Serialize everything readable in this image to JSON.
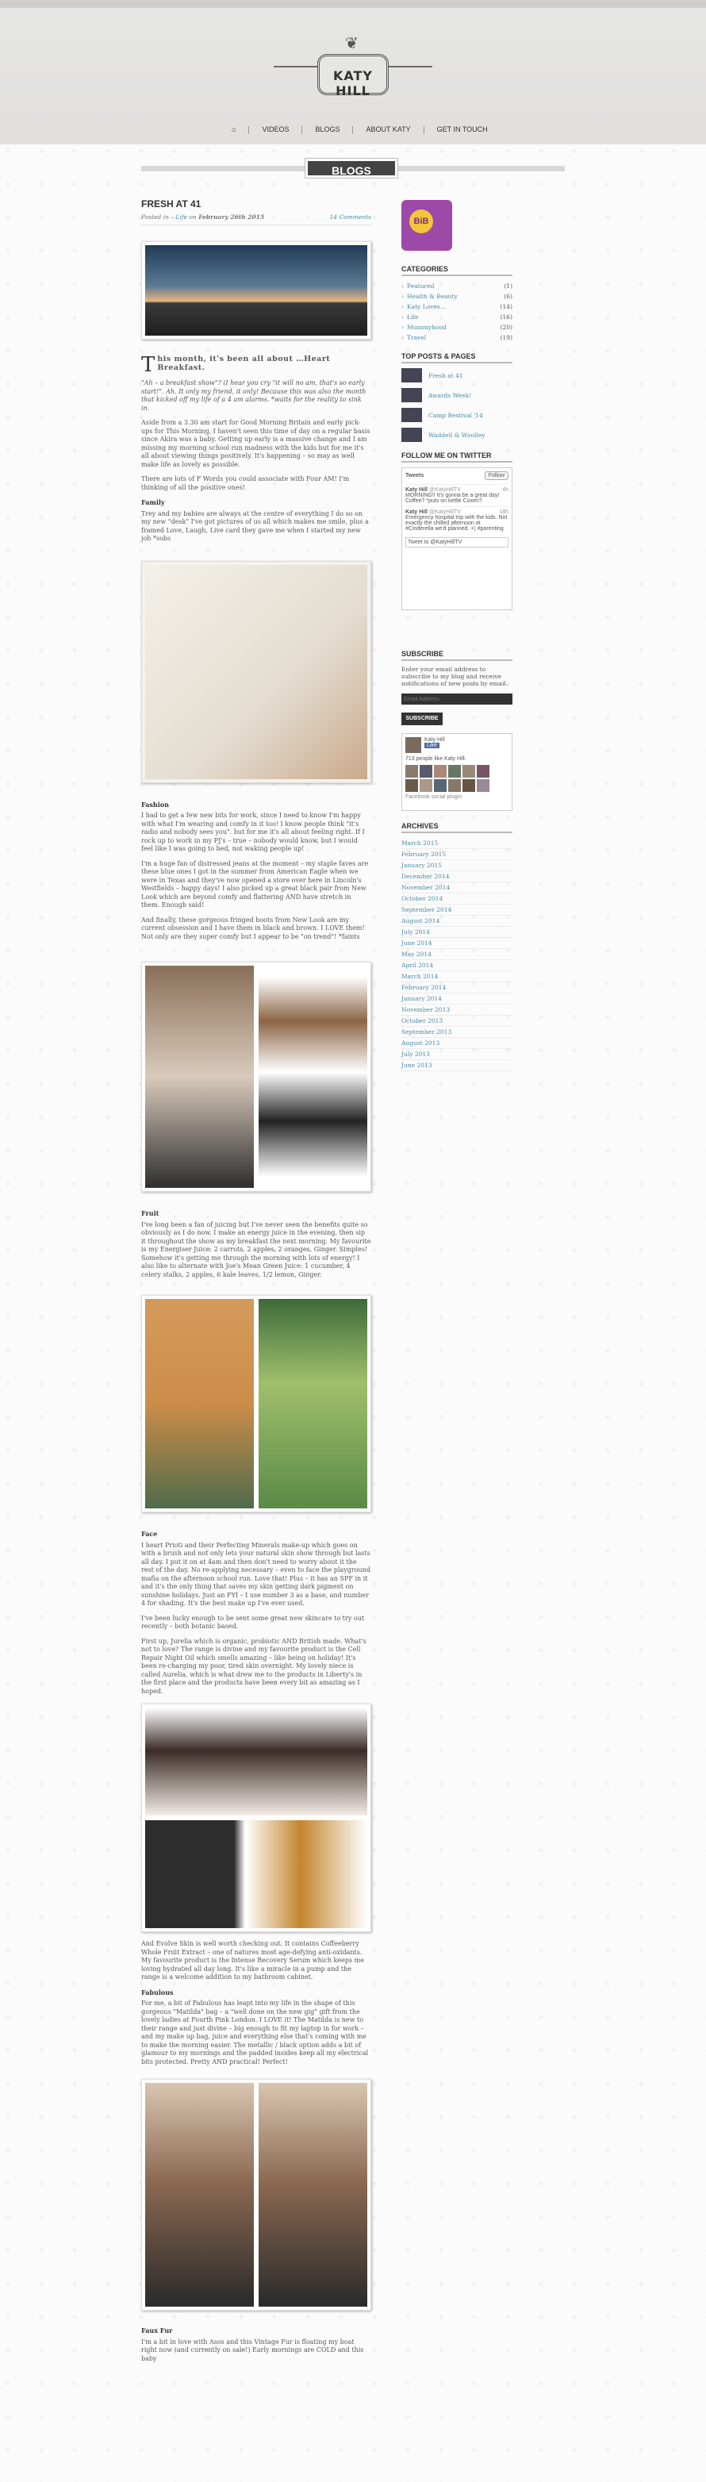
{
  "site": {
    "brand": "KATY HILL"
  },
  "nav": {
    "home": "⌂",
    "videos": "VIDEOS",
    "blogs": "BLOGS",
    "about": "ABOUT KATY",
    "contact": "GET IN TOUCH"
  },
  "section_tag": "BLOGS",
  "post": {
    "title": "FRESH AT 41",
    "posted_in": "Posted in – ",
    "category": "Life",
    "on": " on ",
    "date": "February 26th 2015",
    "comments": "14 Comments",
    "intro_drop": "T",
    "intro_rest": "his month, it's been all about …Heart Breakfast.",
    "p1": "\"Ah – a breakfast show\"? (I hear you cry \"it will no am, that's so early start!\". Ah. It only my friend, it only! Because this was also the month that kicked off my life of a 4 am alarms. *waits for the reality to sink in.",
    "p2": "Aside from a 3.30 am start for Good Morning Britain and early pick-ups for This Morning, I haven't seen this time of day on a regular basis since Akira was a baby. Getting up early is a massive change and I am missing my morning school run madness with the kids but for me it's all about viewing things positively. It's happening – so may as well make life as lovely as possible.",
    "p3": "There are lots of F Words you could associate with Four AM! I'm thinking of all the positive ones!",
    "family_h": "Family",
    "p4": "Trey and my babies are always at the centre of everything I do so on my new \"desk\" I've got pictures of us all which makes me smile, plus a framed Love, Laugh, Live card they gave me when I started my new job *sobs",
    "fashion_h": "Fashion",
    "p5": "I had to get a few new bits for work, since I need to know I'm happy with what I'm wearing and comfy in it too! I know people think \"it's radio and nobody sees you\". but for me it's all about feeling right. If I rock up to work in my PJ's – true – nobody would know, but I would feel like I was going to bed, not waking people up!",
    "p6": "I'm a huge fan of distressed jeans at the moment – my staple faves are these blue ones I got in the summer from American Eagle when we were in Texas and they've now opened a store over here in Lincoln's Westfields – happy days! I also picked up a great black pair from New Look which are beyond comfy and flattering AND have stretch in them. Enough said!",
    "p7": "And finally, these gorgeous fringed boots from New Look are my current obsession and I have them in black and brown. I LOVE them! Not only are they super comfy but I appear to be \"on trend\"! *faints",
    "fruit_h": "Fruit",
    "p8": "I've long been a fan of juicing but I've never seen the benefits quite so obviously as I do now. I make an energy juice in the evening, then sip it throughout the show as my breakfast the next morning. My favourite is my Energiser Juice: 2 carrots, 2 apples, 2 oranges, Ginger. Simples! Somehow it's getting me through the morning with lots of energy! I also like to alternate with Joe's Mean Green Juice: 1 cucumber, 4 celery stalks, 2 apples, 6 kale leaves, 1/2 lemon, Ginger.",
    "face_h": "Face",
    "p9": "I heart Prioti and their Perfecting Minerals make-up which goes on with a brush and not only lets your natural skin show through but lasts all day. I put it on at 4am and then don't need to worry about it the rest of the day. No re-applying necessary – even to face the playground mafia on the afternoon school run. Love that! Plus – it has an SPF in it and it's the only thing that saves my skin getting dark pigment on sunshine holidays. Just an FYI – I use number 3 as a base, and number 4 for shading. It's the best make up I've ever used.",
    "p10": "I've been lucky enough to be sent some great new skincare to try out recently – both botanic based.",
    "p11": "First up, Jurelia which is organic, probiotic AND British made. What's not to love? The range is divine and my favourite product is the Cell Repair Night Oil which smells amazing – like being on holiday! It's been re-charging my poor, tired skin overnight. My lovely niece is called Aurelia, which is what drew me to the products in Liberty's in the first place and the products have been every bit as amazing as I hoped.",
    "p12": "And Evolve Skin is well worth checking out. It contains Coffeeberry Whole Fruit Extract – one of natures most age-defying anti-oxidants. My favourite product is the Intense Recovery Serum which keeps me loving hydrated all day long. It's like a miracle in a pump and the range is a welcome addition to my bathroom cabinet.",
    "fab_h": "Fabulous",
    "p13": "For me, a bit of Fabulous has leapt into my life in the shape of this gorgeous \"Matilda\" bag – a \"well done on the new gig\" gift from the lovely ladies at Fourth Pink London. I LOVE it! The Matilda is new to their range and just divine – big enough to fit my laptop in for work – and my make up bag, juice and everything else that's coming with me to make the morning easier. The metallic / black option adds a bit of glamour to my mornings and the padded insides keep all my electrical bits protected. Pretty AND practical! Perfect!",
    "faux_h": "Faux Fur",
    "p14": "I'm a bit in love with Asos and this Vintage Fur is floating my boat right now (and currently on sale!) Early mornings are COLD and this baby"
  },
  "sidebar": {
    "badge": "BiB",
    "categories_h": "CATEGORIES",
    "categories": [
      {
        "name": "Featured",
        "count": "(1)"
      },
      {
        "name": "Health & Beauty",
        "count": "(6)"
      },
      {
        "name": "Katy Loves…",
        "count": "(14)"
      },
      {
        "name": "Life",
        "count": "(16)"
      },
      {
        "name": "Mummyhood",
        "count": "(20)"
      },
      {
        "name": "Travel",
        "count": "(19)"
      }
    ],
    "top_h": "TOP POSTS & PAGES",
    "top": [
      "Fresh at 41",
      "Awards Week!",
      "Camp Bestival '14",
      "Waddell & Woolley"
    ],
    "twitter_h": "FOLLOW ME ON TWITTER",
    "tweets_label": "Tweets",
    "follow": "Follow",
    "tweet1_name": "Katy Hill",
    "tweet1_handle": "@KatyHillTV",
    "tweet1_time": "4h",
    "tweet1_text": "MORNING!! It's gonna be a great day! Coffee? *puts on kettle Coxen?",
    "tweet2_name": "Katy Hill",
    "tweet2_handle": "@KatyHillTV",
    "tweet2_time": "18h",
    "tweet2_text": "Emergency hospital trip with the kids. Not exactly the chilled afternoon at #Cinderella we'd planned. +) #parenting",
    "tweet_to": "Tweet to @KatyHillTV",
    "subscribe_h": "SUBSCRIBE",
    "subscribe_text": "Enter your email address to subscribe to my blog and receive notifications of new posts by email.",
    "email_placeholder": "Email Address",
    "subscribe_btn": "SUBSCRIBE",
    "fb_name": "Katy Hill",
    "fb_like": "Like",
    "fb_count": "713 people like Katy Hill.",
    "fb_plugin": "Facebook social plugin",
    "archives_h": "ARCHIVES",
    "archives": [
      "March 2015",
      "February 2015",
      "January 2015",
      "December 2014",
      "November 2014",
      "October 2014",
      "September 2014",
      "August 2014",
      "July 2014",
      "June 2014",
      "May 2014",
      "April 2014",
      "March 2014",
      "February 2014",
      "January 2014",
      "November 2013",
      "October 2013",
      "September 2013",
      "August 2013",
      "July 2013",
      "June 2013"
    ]
  }
}
